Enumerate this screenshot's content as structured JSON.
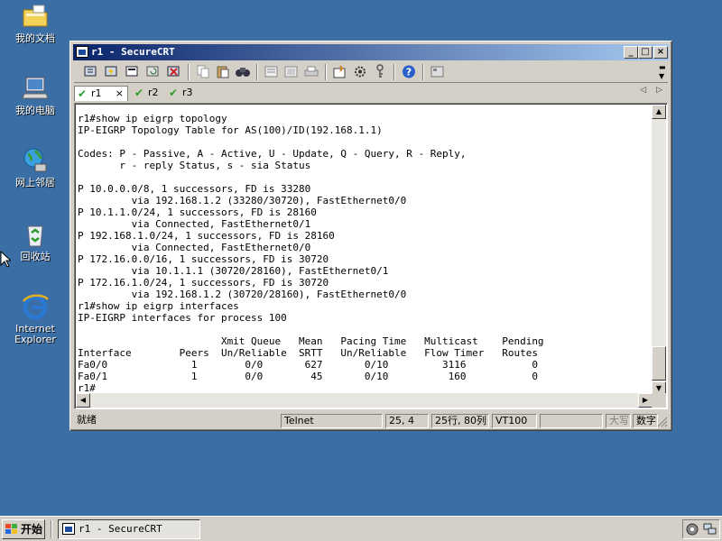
{
  "desktop": {
    "icons": [
      {
        "label": "我的文档"
      },
      {
        "label": "我的电脑"
      },
      {
        "label": "网上邻居"
      },
      {
        "label": "回收站"
      },
      {
        "label_line1": "Internet",
        "label_line2": "Explorer"
      }
    ]
  },
  "window": {
    "title": "r1 - SecureCRT",
    "controls": {
      "minimize": "_",
      "maximize": "□",
      "close": "×"
    }
  },
  "tabs": [
    {
      "label": "r1",
      "active": true,
      "close": "×"
    },
    {
      "label": "r2",
      "active": false
    },
    {
      "label": "r3",
      "active": false
    }
  ],
  "terminal": {
    "lines": [
      "r1#show ip eigrp topology",
      "IP-EIGRP Topology Table for AS(100)/ID(192.168.1.1)",
      "",
      "Codes: P - Passive, A - Active, U - Update, Q - Query, R - Reply,",
      "       r - reply Status, s - sia Status",
      "",
      "P 10.0.0.0/8, 1 successors, FD is 33280",
      "         via 192.168.1.2 (33280/30720), FastEthernet0/0",
      "P 10.1.1.0/24, 1 successors, FD is 28160",
      "         via Connected, FastEthernet0/1",
      "P 192.168.1.0/24, 1 successors, FD is 28160",
      "         via Connected, FastEthernet0/0",
      "P 172.16.0.0/16, 1 successors, FD is 30720",
      "         via 10.1.1.1 (30720/28160), FastEthernet0/1",
      "P 172.16.1.0/24, 1 successors, FD is 30720",
      "         via 192.168.1.2 (30720/28160), FastEthernet0/0",
      "r1#show ip eigrp interfaces",
      "IP-EIGRP interfaces for process 100",
      "",
      "                        Xmit Queue   Mean   Pacing Time   Multicast    Pending",
      "Interface        Peers  Un/Reliable  SRTT   Un/Reliable   Flow Timer   Routes",
      "Fa0/0              1        0/0       627       0/10         3116           0",
      "Fa0/1              1        0/0        45       0/10          160           0",
      "r1#"
    ]
  },
  "statusbar": {
    "ready": "就绪",
    "protocol": "Telnet",
    "cursor": "25,  4",
    "size": "25行, 80列",
    "emulation": "VT100",
    "caps": "大写",
    "num": "数字"
  },
  "taskbar": {
    "start_label": "开始",
    "task_label": "r1 - SecureCRT"
  }
}
